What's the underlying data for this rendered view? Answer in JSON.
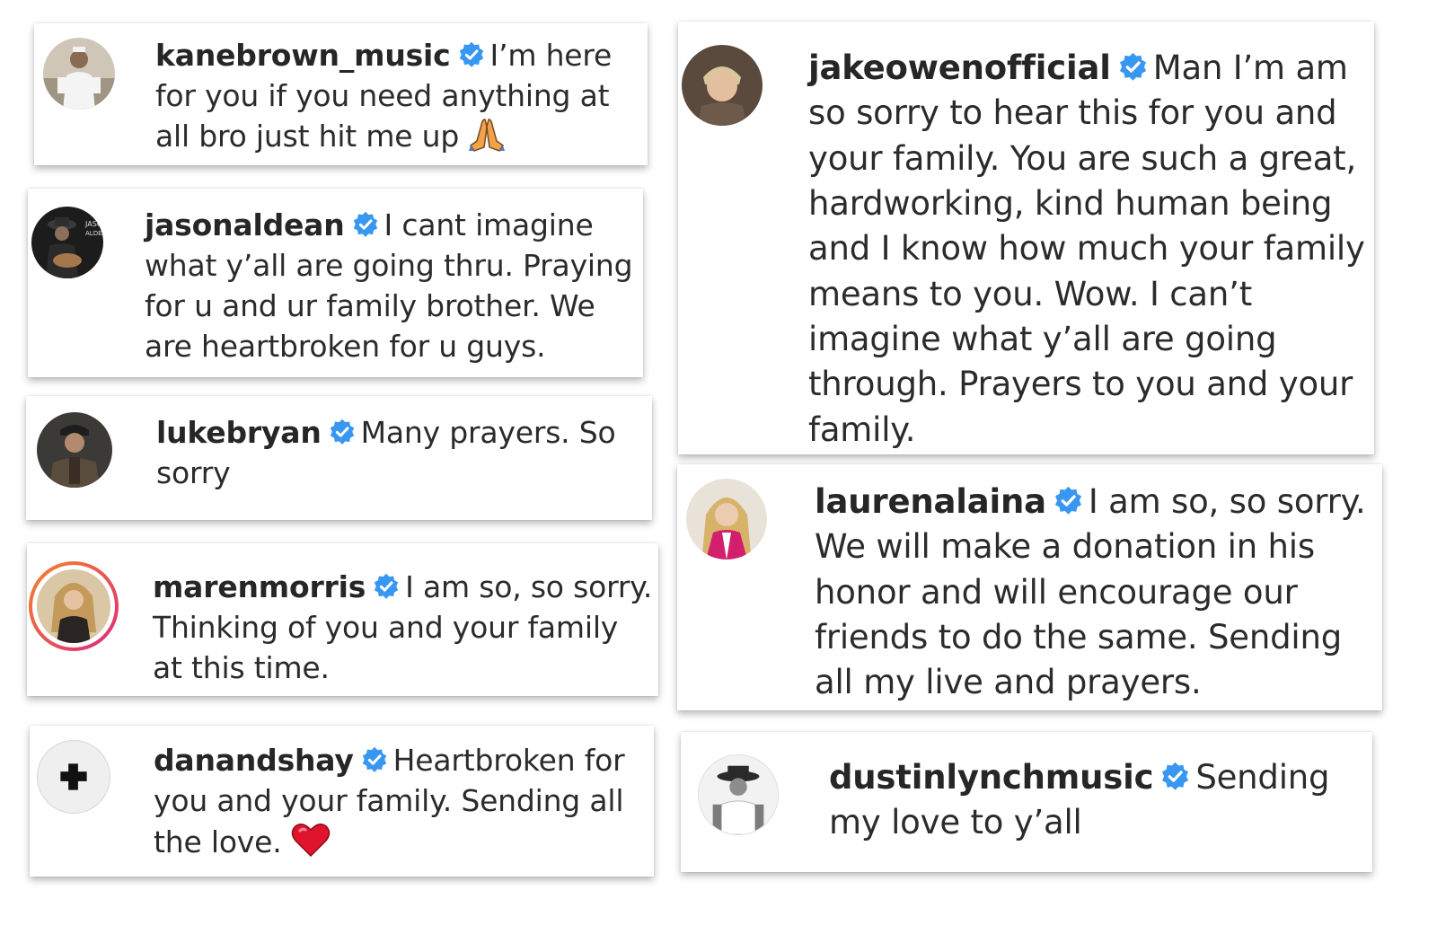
{
  "comments": [
    {
      "username": "kanebrown_music",
      "verified": true,
      "text": "I’m here for you if you need anything at all bro just hit me up",
      "emoji": "folded-hands-icon"
    },
    {
      "username": "jasonaldean",
      "verified": true,
      "text": "I cant imagine what y’all are going thru. Praying for u and ur family brother. We are heartbroken for u guys."
    },
    {
      "username": "lukebryan",
      "verified": true,
      "text": "Many prayers. So sorry"
    },
    {
      "username": "marenmorris",
      "verified": true,
      "text": "I am so, so sorry. Thinking of you and your family at this time."
    },
    {
      "username": "danandshay",
      "verified": true,
      "text": "Heartbroken for you and your family. Sending all the love.",
      "emoji": "red-heart-icon"
    },
    {
      "username": "jakeowenofficial",
      "verified": true,
      "text": "Man I’m am so sorry to hear this for you and your family. You are such a great, hardworking, kind human being and I know how much your family means to you. Wow. I can’t imagine what y’all are going through. Prayers to you and your family."
    },
    {
      "username": "laurenalaina",
      "verified": true,
      "text": "I am so, so sorry. We will make a donation in his honor and will encourage our friends to do the same. Sending all my live and prayers."
    },
    {
      "username": "dustinlynchmusic",
      "verified": true,
      "text": "Sending my love to y’all"
    }
  ],
  "colors": {
    "verified_blue": "#3897f0",
    "story_ring_start": "#f58529",
    "story_ring_end": "#dd2a7b"
  }
}
